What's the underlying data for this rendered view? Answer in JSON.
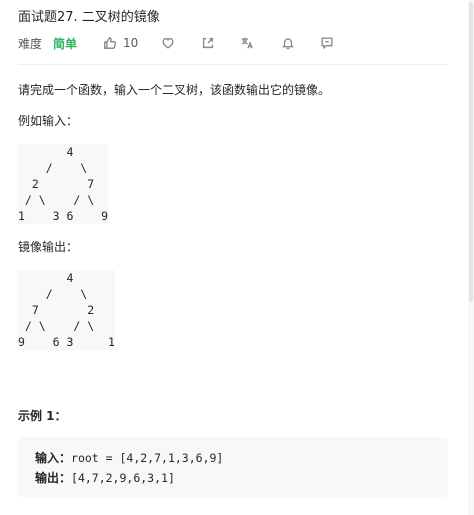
{
  "problem": {
    "title": "面试题27. 二叉树的镜像",
    "difficulty_label": "难度",
    "difficulty_value": "简单",
    "like_count": "10",
    "icons": {
      "like": "thumbs-up-icon",
      "favorite": "heart-icon",
      "share": "share-icon",
      "translate": "translate-icon",
      "notify": "bell-icon",
      "feedback": "comment-icon"
    },
    "colors": {
      "difficulty_easy": "#2db55d",
      "code_background": "#f7f8fa"
    }
  },
  "content": {
    "description": "请完成一个函数，输入一个二叉树，该函数输出它的镜像。",
    "example_input_label": "例如输入：",
    "input_tree": "       4\n    /    \\\n  2       7\n / \\    / \\\n1    3 6    9",
    "example_output_label": "镜像输出：",
    "output_tree": "       4\n    /    \\\n  7       2\n / \\    / \\\n9    6 3     1",
    "example_title": "示例 1：",
    "example_input_key": "输入：",
    "example_input_value": "root = [4,2,7,1,3,6,9]",
    "example_output_key": "输出：",
    "example_output_value": "[4,7,2,9,6,3,1]"
  }
}
